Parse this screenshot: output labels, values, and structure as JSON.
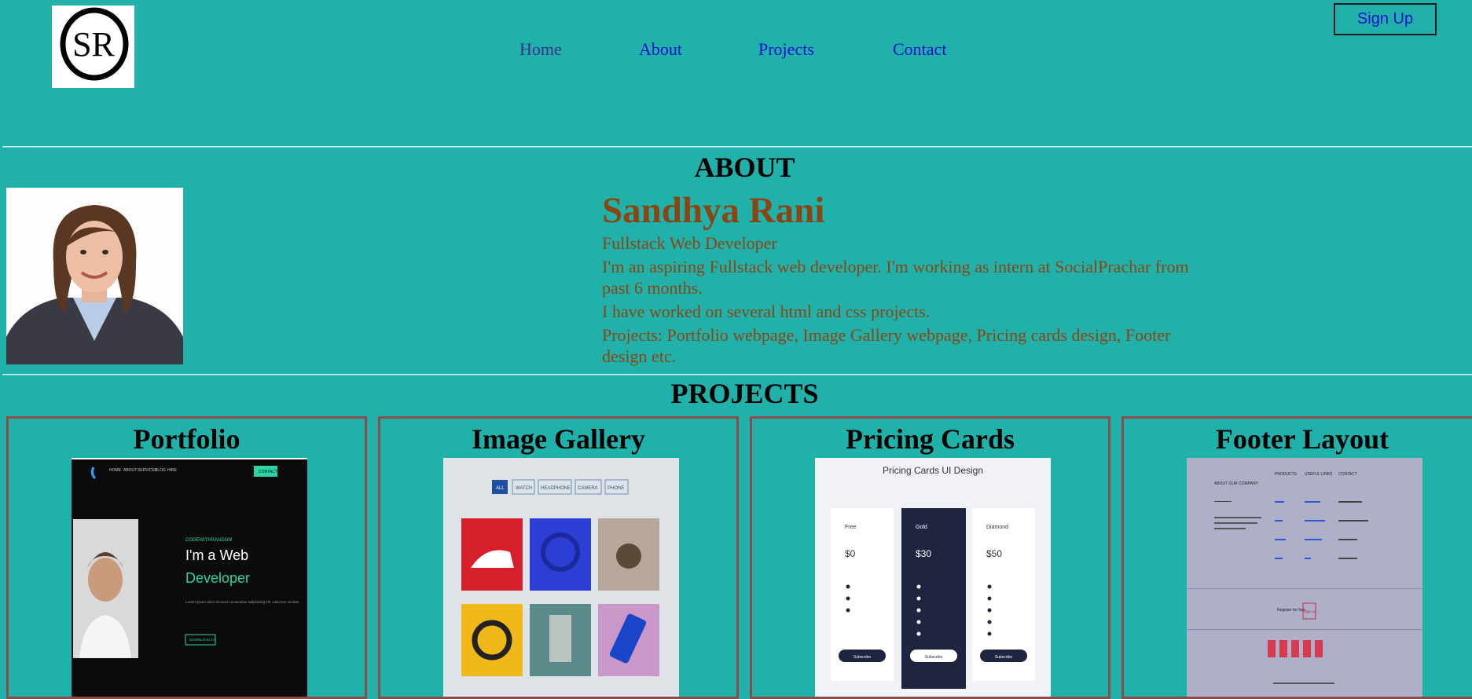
{
  "header": {
    "logo_text": "SR",
    "nav": [
      {
        "label": "Home",
        "color": "#3b2f8f"
      },
      {
        "label": "About",
        "color": "#1010d0"
      },
      {
        "label": "Projects",
        "color": "#1010d0"
      },
      {
        "label": "Contact",
        "color": "#1010d0"
      }
    ],
    "signup_label": "Sign Up"
  },
  "about": {
    "heading": "ABOUT",
    "name": "Sandhya Rani",
    "role": "Fullstack Web Developer",
    "intro": "I'm an aspiring Fullstack web developer. I'm working as intern at SocialPrachar from past 6 months.",
    "experience": "I have worked on several html and css projects.",
    "projects_line": "Projects: Portfolio webpage, Image Gallery webpage, Pricing cards design, Footer design etc."
  },
  "projects": {
    "heading": "PROJECTS",
    "cards": [
      {
        "title": "Portfolio"
      },
      {
        "title": "Image Gallery"
      },
      {
        "title": "Pricing Cards"
      },
      {
        "title": "Footer Layout"
      }
    ],
    "portfolio_thumb": {
      "nav_items": [
        "HOME",
        "ABOUT",
        "SERVICES",
        "BLOG",
        "HIRE"
      ],
      "contact_btn": "CONTACT",
      "tagline": "CODEWITHRANDOM",
      "headline_1": "I'm a Web",
      "headline_2": "Developer",
      "body": "Lorem ipsum dolor sit amet consectetur adipisicing elit. Laborum minima",
      "download_btn": "DOWNLOAD CV"
    },
    "gallery_thumb": {
      "filters": [
        "ALL",
        "WATCH",
        "HEADPHONE",
        "CAMERA",
        "PHONE"
      ]
    },
    "pricing_thumb": {
      "title": "Pricing Cards UI Design",
      "plans": [
        {
          "name": "Free",
          "price": "$0",
          "button": "Subscribe"
        },
        {
          "name": "Gold",
          "price": "$30",
          "button": "Subscribe"
        },
        {
          "name": "Diamond",
          "price": "$50",
          "button": "Subscribe"
        }
      ]
    },
    "footer_thumb": {
      "col_about": "ABOUT OUR COMPANY",
      "col_products": "PRODUCTS",
      "col_links": "USEFUL LINKS",
      "col_contact": "CONTACT",
      "register": "Register for free",
      "signup": "Sign up"
    }
  },
  "colors": {
    "background": "#20b2aa",
    "about_text": "#8b4513",
    "card_border": "#8b4c4c"
  }
}
